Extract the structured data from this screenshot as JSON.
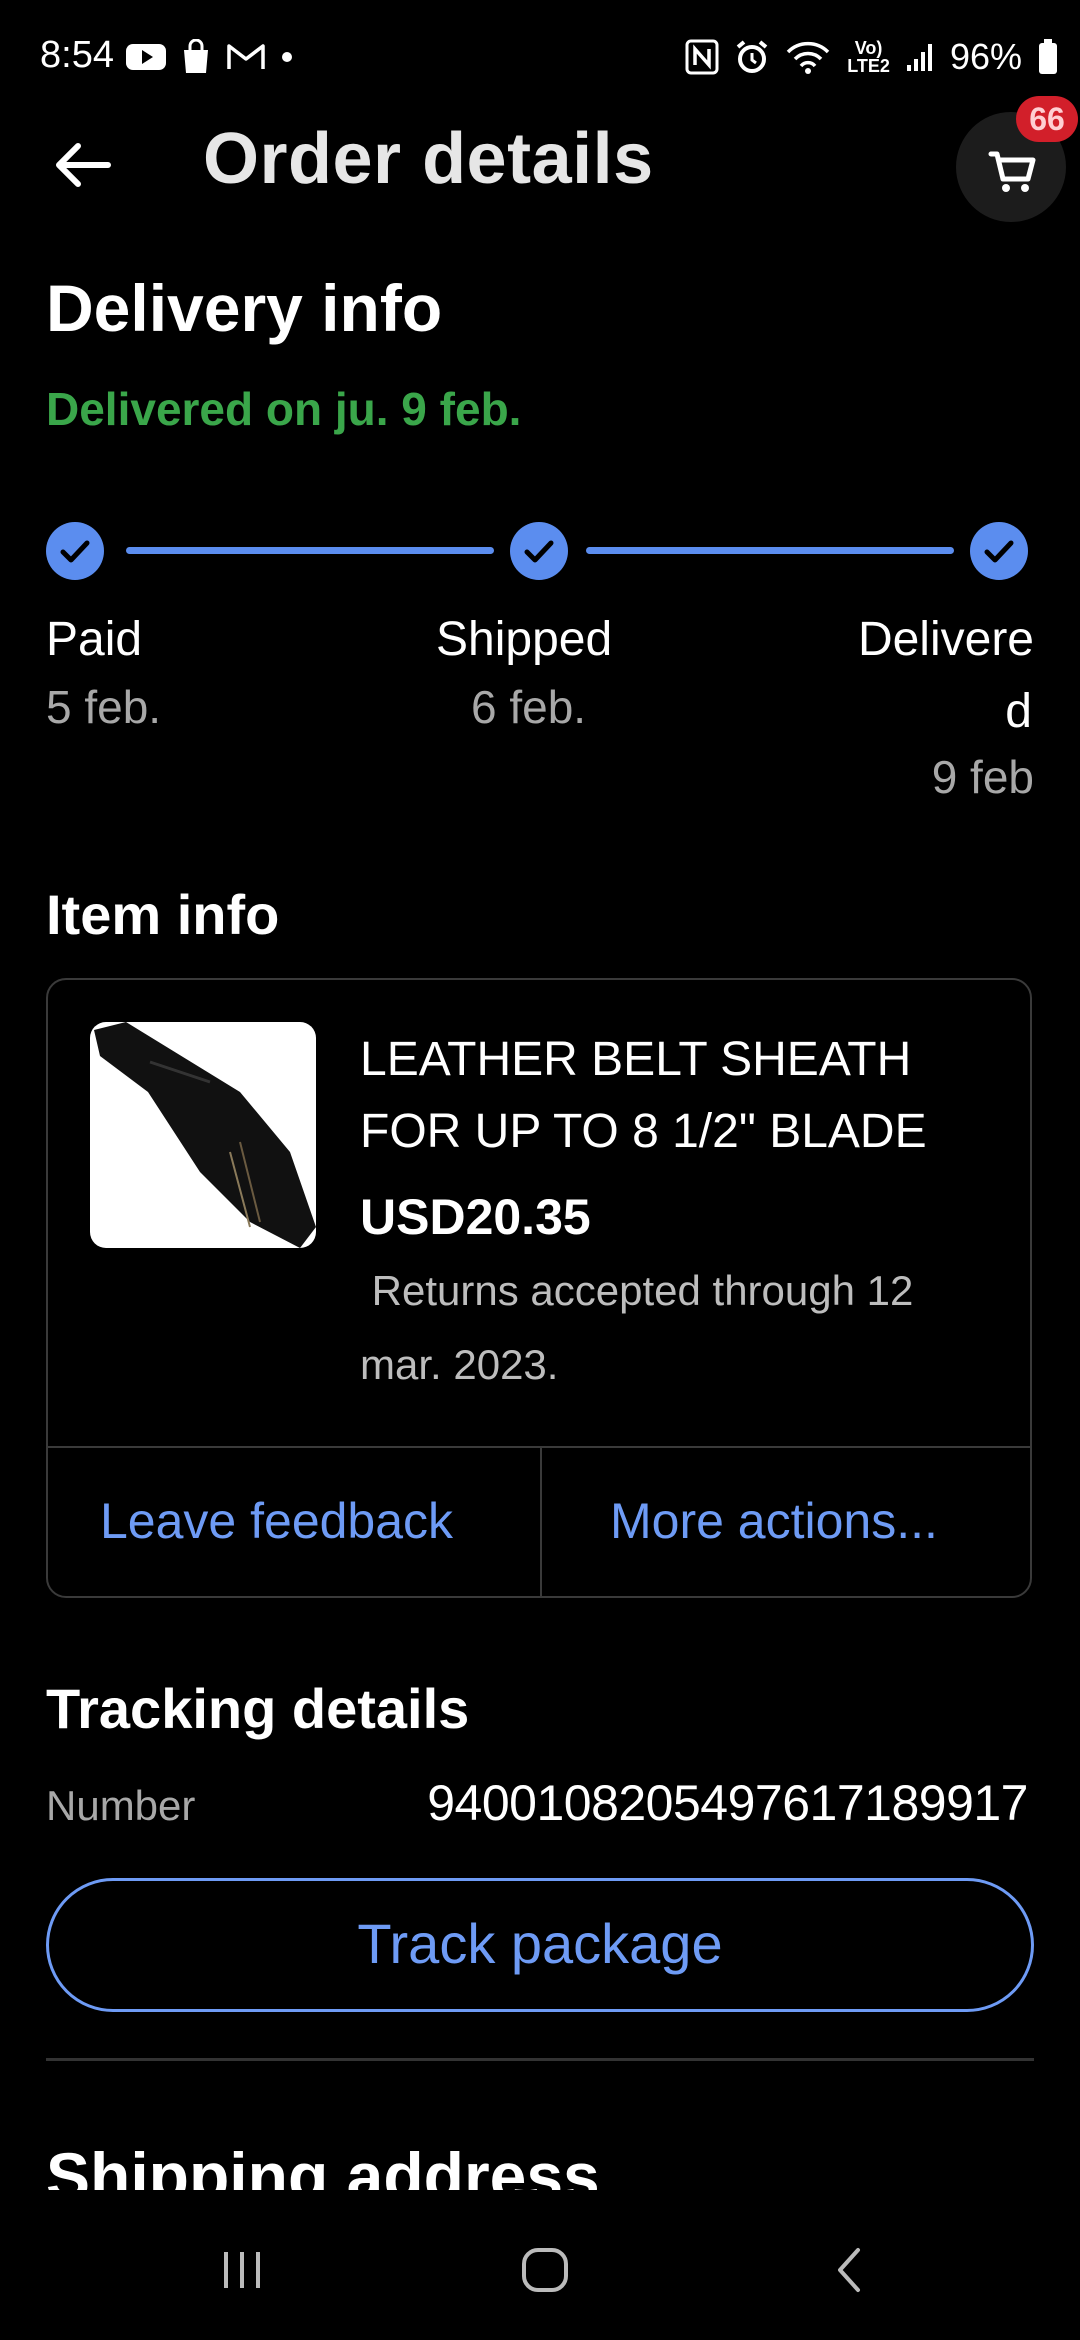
{
  "status_bar": {
    "time": "8:54",
    "battery": "96%",
    "network": "LTE2"
  },
  "app_bar": {
    "title": "Order details",
    "cart_count": "66"
  },
  "delivery": {
    "heading": "Delivery info",
    "status": "Delivered on ju. 9 feb.",
    "steps": [
      {
        "label": "Paid",
        "date": "5 feb."
      },
      {
        "label": "Shipped",
        "date": "6 feb."
      },
      {
        "label_line1": "Delivere",
        "label_line2": "d",
        "date": "9 feb"
      }
    ]
  },
  "item_info": {
    "heading": "Item info",
    "title": "LEATHER BELT SHEATH FOR UP TO 8 1/2\" BLADE",
    "price": "USD20.35",
    "returns": " Returns accepted through 12 mar. 2023.",
    "actions": [
      "Leave feedback",
      "More actions..."
    ]
  },
  "tracking": {
    "heading": "Tracking details",
    "number_label": "Number",
    "number": "9400108205497617189917",
    "button": "Track package"
  },
  "shipping": {
    "heading": "Shipping address"
  },
  "colors": {
    "accent": "#5b8def",
    "link": "#6e9bf5",
    "success": "#3aa64a",
    "badge": "#d21f2a"
  },
  "icons": [
    "back-arrow-icon",
    "cart-icon",
    "check-icon",
    "nav-recents-icon",
    "nav-home-icon",
    "nav-back-icon"
  ]
}
